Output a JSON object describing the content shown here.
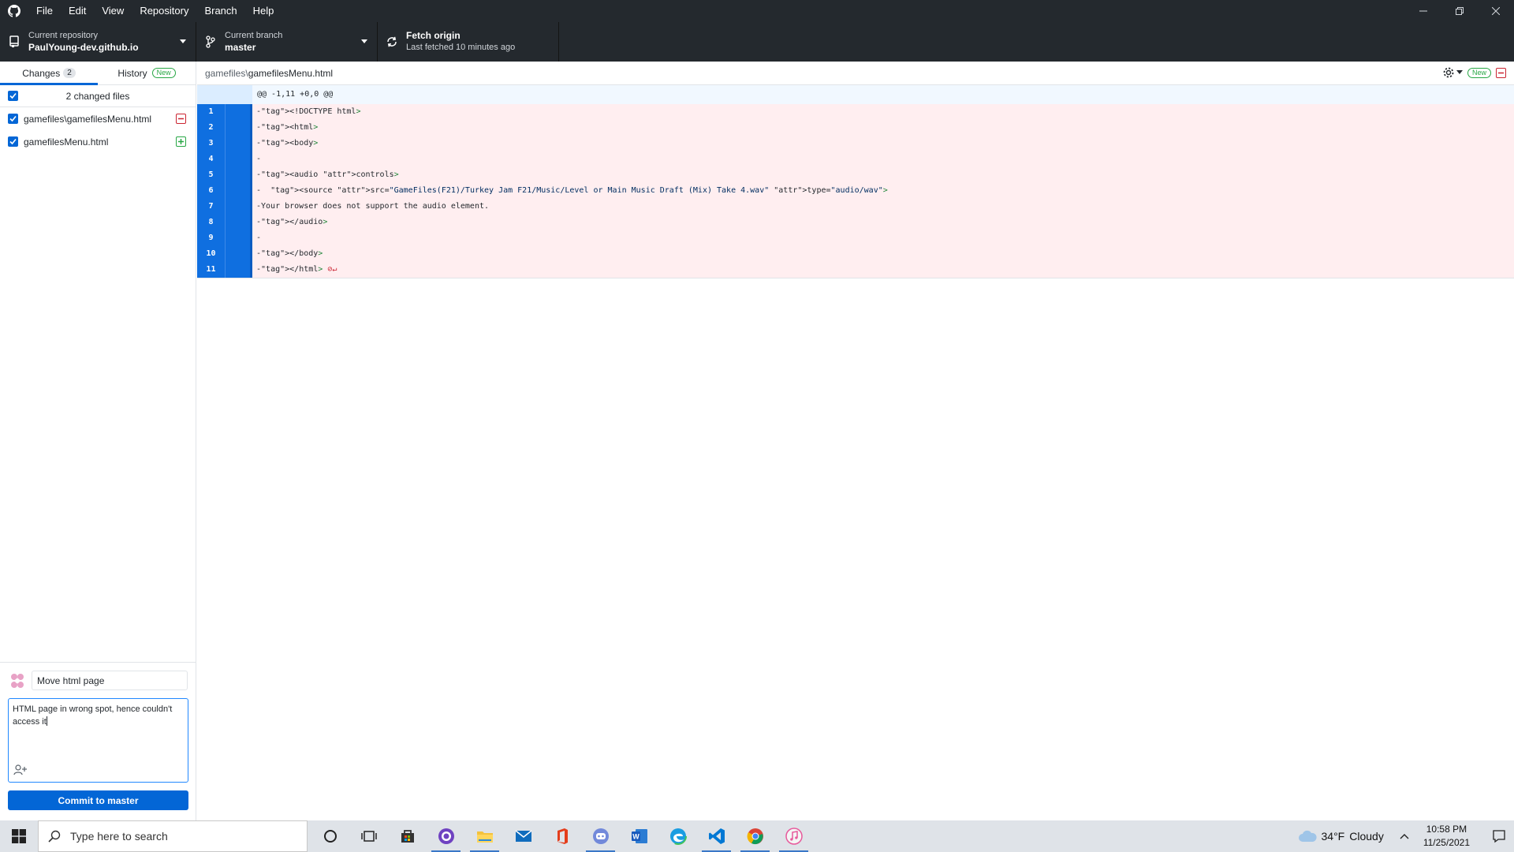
{
  "menu": [
    "File",
    "Edit",
    "View",
    "Repository",
    "Branch",
    "Help"
  ],
  "toolbar": {
    "repo_label": "Current repository",
    "repo_value": "PaulYoung-dev.github.io",
    "branch_label": "Current branch",
    "branch_value": "master",
    "fetch_label": "Fetch origin",
    "fetch_sub": "Last fetched 10 minutes ago"
  },
  "tabs": {
    "changes_label": "Changes",
    "changes_count": "2",
    "history_label": "History",
    "history_badge": "New"
  },
  "files": {
    "header": "2 changed files",
    "items": [
      {
        "name": "gamefiles\\gamefilesMenu.html",
        "status": "deleted"
      },
      {
        "name": "gamefilesMenu.html",
        "status": "added"
      }
    ]
  },
  "commit": {
    "summary": "Move html page",
    "description": "HTML page in wrong spot, hence couldn't access it",
    "button_label": "Commit to master"
  },
  "diff": {
    "path_dir": "gamefiles\\",
    "path_file": "gamefilesMenu.html",
    "new_badge": "New",
    "hunk": "@@ -1,11 +0,0 @@",
    "lines": [
      {
        "num": "1",
        "text": "-<!DOCTYPE html>"
      },
      {
        "num": "2",
        "text": "-<html>"
      },
      {
        "num": "3",
        "text": "-<body>"
      },
      {
        "num": "4",
        "text": "-"
      },
      {
        "num": "5",
        "text": "-<audio controls>"
      },
      {
        "num": "6",
        "text": "-  <source src=\"GameFiles(F21)/Turkey Jam F21/Music/Level or Main Music Draft (Mix) Take 4.wav\" type=\"audio/wav\">"
      },
      {
        "num": "7",
        "text": "-Your browser does not support the audio element."
      },
      {
        "num": "8",
        "text": "-</audio>"
      },
      {
        "num": "9",
        "text": "-"
      },
      {
        "num": "10",
        "text": "-</body>"
      },
      {
        "num": "11",
        "text": "-</html>"
      }
    ]
  },
  "taskbar": {
    "search_placeholder": "Type here to search",
    "weather_temp": "34°F",
    "weather_desc": "Cloudy",
    "time": "10:58 PM",
    "date": "11/25/2021"
  },
  "colors": {
    "accent": "#0366d6",
    "deleted": "#cb2431",
    "added": "#28a745",
    "diff_deleted_bg": "#ffeef0",
    "gutter": "#0f6fe0"
  }
}
